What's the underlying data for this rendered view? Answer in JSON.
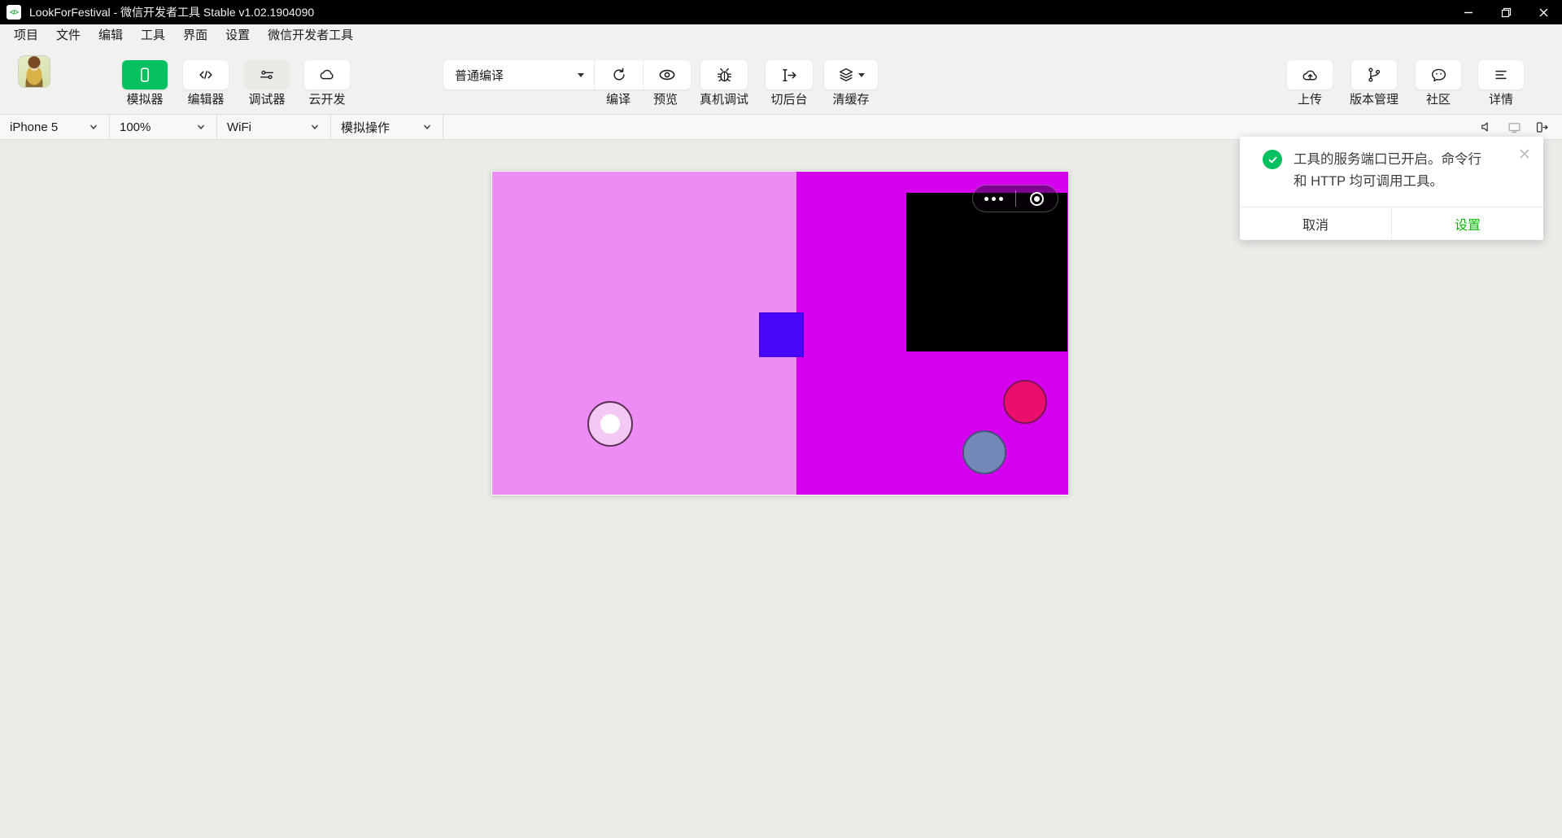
{
  "window": {
    "title": "LookForFestival - 微信开发者工具 Stable v1.02.1904090",
    "app_icon_glyph": "</>"
  },
  "menubar": {
    "items": [
      "项目",
      "文件",
      "编辑",
      "工具",
      "界面",
      "设置",
      "微信开发者工具"
    ]
  },
  "toolbar": {
    "simulator_label": "模拟器",
    "editor_label": "编辑器",
    "debugger_label": "调试器",
    "cloud_label": "云开发",
    "compile_mode_value": "普通编译",
    "compile_label": "编译",
    "preview_label": "预览",
    "remote_debug_label": "真机调试",
    "switch_background_label": "切后台",
    "clear_cache_label": "清缓存",
    "upload_label": "上传",
    "version_label": "版本管理",
    "community_label": "社区",
    "details_label": "详情"
  },
  "devicebar": {
    "device": "iPhone 5",
    "scale": "100%",
    "network": "WiFi",
    "action": "模拟操作"
  },
  "notification": {
    "line1": "工具的服务端口已开启。命令行",
    "line2": "和 HTTP 均可调用工具。",
    "cancel_label": "取消",
    "confirm_label": "设置",
    "close_glyph": "✕"
  },
  "simulator": {
    "capsule_icons": [
      "more-dots-icon",
      "circle-dot-icon"
    ]
  },
  "colors": {
    "titlebar_bg": "#000000",
    "chrome_bg": "#F1F1EF",
    "accent_green": "#07C160",
    "link_green": "#09BB07",
    "canvas_left": "#EE8CF5",
    "canvas_right": "#D400EE",
    "blue_square": "#4806FA",
    "crimson_circle": "#EC0E6D",
    "slate_circle": "#7488B8",
    "pink_ring_circle": "#F3C9F3",
    "black_panel": "#000000"
  }
}
